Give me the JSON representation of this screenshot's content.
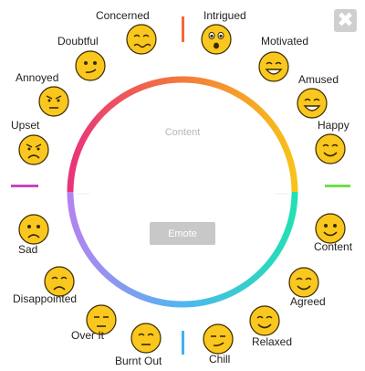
{
  "dialog": {
    "close_label": "✖",
    "center_label": "Content",
    "emote_button": "Emote"
  },
  "colors": {
    "wheel_top": "#f47a3a",
    "wheel_left": "#e8357a",
    "wheel_right": "#f7c21a",
    "wheel_right_low": "#22e0b2",
    "wheel_bottom": "#4fb6f0",
    "wheel_left_low": "#b483f0",
    "face_fill": "#f9c71e",
    "face_stroke": "#3a2a00"
  },
  "emotions": [
    {
      "label": "Concerned",
      "icon": "concerned-face-icon"
    },
    {
      "label": "Intrigued",
      "icon": "intrigued-face-icon"
    },
    {
      "label": "Motivated",
      "icon": "motivated-face-icon"
    },
    {
      "label": "Amused",
      "icon": "amused-face-icon"
    },
    {
      "label": "Happy",
      "icon": "happy-face-icon"
    },
    {
      "label": "Content",
      "icon": "content-face-icon"
    },
    {
      "label": "Agreed",
      "icon": "agreed-face-icon"
    },
    {
      "label": "Relaxed",
      "icon": "relaxed-face-icon"
    },
    {
      "label": "Chill",
      "icon": "chill-face-icon"
    },
    {
      "label": "Burnt Out",
      "icon": "burnt-out-face-icon"
    },
    {
      "label": "Over It",
      "icon": "over-it-face-icon"
    },
    {
      "label": "Disappointed",
      "icon": "disappointed-face-icon"
    },
    {
      "label": "Sad",
      "icon": "sad-face-icon"
    },
    {
      "label": "Upset",
      "icon": "upset-face-icon"
    },
    {
      "label": "Annoyed",
      "icon": "annoyed-face-icon"
    },
    {
      "label": "Doubtful",
      "icon": "doubtful-face-icon"
    }
  ]
}
